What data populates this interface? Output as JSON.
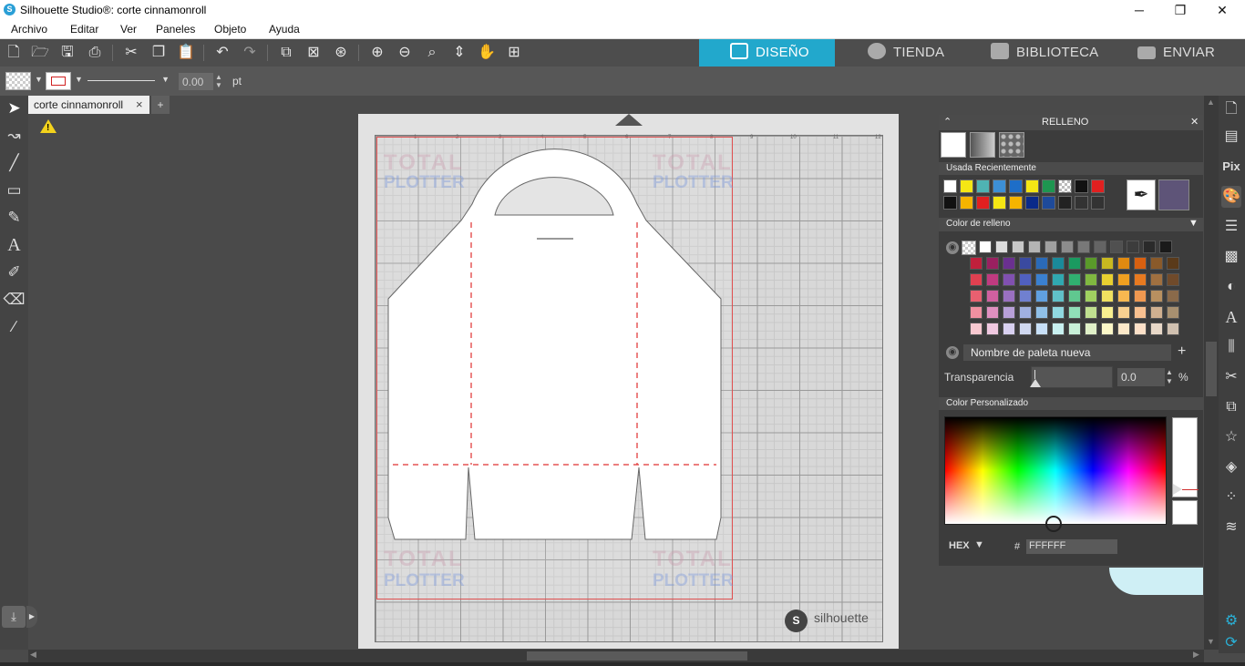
{
  "window": {
    "title": "Silhouette Studio®: corte cinnamonroll",
    "minimize": "─",
    "maximize": "❐",
    "close": "✕"
  },
  "menu": [
    "Archivo",
    "Editar",
    "Ver",
    "Paneles",
    "Objeto",
    "Ayuda"
  ],
  "nav": {
    "design": "DISEÑO",
    "store": "TIENDA",
    "library": "BIBLIOTECA",
    "send": "ENVIAR"
  },
  "options": {
    "line_width": "0.00",
    "unit": "pt"
  },
  "tab": {
    "label": "corte cinnamonroll",
    "close": "×",
    "add": "+"
  },
  "mat": {
    "brand": "silhouette",
    "ruler_top": [
      "1",
      "2",
      "3",
      "4",
      "5",
      "6",
      "7",
      "8",
      "9",
      "10",
      "11",
      "12"
    ],
    "ruler_left": [
      "1",
      "2",
      "3",
      "4",
      "5",
      "6",
      "7",
      "8",
      "9",
      "10",
      "11",
      "12"
    ],
    "watermark_1": "TOTAL",
    "watermark_2": "PLOTTER"
  },
  "panel": {
    "title": "RELLENO",
    "recent_label": "Usada Recientemente",
    "fill_color_label": "Color de relleno",
    "palette_name": "Nombre de paleta nueva",
    "transparency_label": "Transparencia",
    "transparency_value": "0.0",
    "transparency_unit": "%",
    "custom_color_label": "Color Personalizado",
    "hex_label": "HEX",
    "hash": "#",
    "hex_value": "FFFFFF",
    "current_color": "#5e5478",
    "recent_row1": [
      "#ffffff",
      "#f5e614",
      "#4fb3b3",
      "#3d8fd6",
      "#1e6ec8",
      "#f5e614",
      "#1e9650",
      "transparent",
      "#111111",
      "#e02020"
    ],
    "recent_row2": [
      "#111111",
      "#f5b400",
      "#e02020",
      "#f5e614",
      "#f5b400",
      "#0a2a8a",
      "#1e4a9a",
      "#222222",
      "#333333",
      "#333333"
    ],
    "palette_rows": [
      [
        "#ffffff",
        "#dddddd",
        "#c8c8c8",
        "#b4b4b4",
        "#a0a0a0",
        "#8c8c8c",
        "#787878",
        "#646464",
        "#505050",
        "#3c3c3c",
        "#2a2a2a",
        "#1a1a1a",
        "#000000"
      ],
      [
        "#c0203c",
        "#9a2060",
        "#6a3090",
        "#3a4aa0",
        "#2a6ab8",
        "#1a8a9a",
        "#1a9a60",
        "#5a9a2a",
        "#c8b820",
        "#e08a10",
        "#d86010",
        "#8a5a2a",
        "#5a3a1a"
      ],
      [
        "#e04050",
        "#c03a80",
        "#8050b0",
        "#5060c0",
        "#3a80d0",
        "#30a8b0",
        "#30b070",
        "#80b840",
        "#e8d030",
        "#f0a020",
        "#e87a20",
        "#a07040",
        "#704a2a"
      ],
      [
        "#e86070",
        "#d060a0",
        "#9a70c0",
        "#7080d0",
        "#60a0e0",
        "#60c0c8",
        "#60c890",
        "#a0d060",
        "#f0e060",
        "#f8b850",
        "#f09850",
        "#b89060",
        "#8a6a4a"
      ],
      [
        "#f090a0",
        "#e090c0",
        "#b8a0d8",
        "#a0b0e0",
        "#90c0e8",
        "#90d8e0",
        "#90e0b8",
        "#c0e090",
        "#f8f090",
        "#f8d090",
        "#f8c090",
        "#d0b090",
        "#a89070"
      ],
      [
        "#f8c8d0",
        "#f0c8e0",
        "#d8d0f0",
        "#d0d8f0",
        "#c8e0f8",
        "#c8f0f0",
        "#c8f0d8",
        "#e0f0c8",
        "#fcf8c8",
        "#fce8c8",
        "#fce0c8",
        "#e8d8c8",
        "#d0c0b0"
      ]
    ]
  }
}
